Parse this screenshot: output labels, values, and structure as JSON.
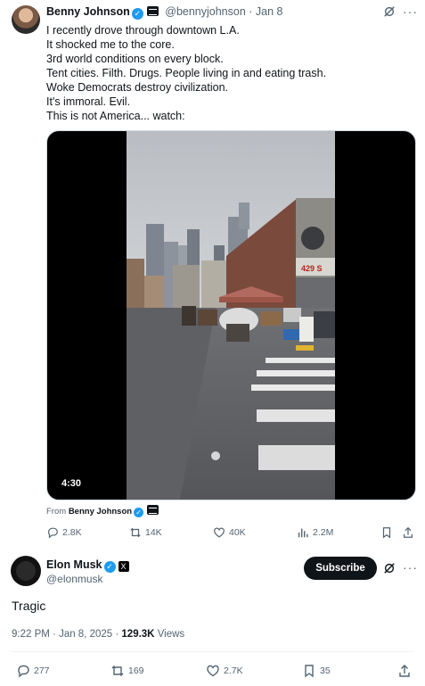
{
  "tweet1": {
    "author_name": "Benny Johnson",
    "handle": "@bennyjohnson",
    "date": "Jan 8",
    "lines": [
      "I recently drove through downtown L.A.",
      "It shocked me to the core.",
      "3rd world conditions on every block.",
      "Tent cities. Filth. Drugs. People living in and eating trash.",
      "Woke Democrats destroy civilization.",
      "It's immoral. Evil.",
      "This is not America... watch:"
    ],
    "video_duration": "4:30",
    "from_label": "From",
    "from_name": "Benny Johnson",
    "replies": "2.8K",
    "reposts": "14K",
    "likes": "40K",
    "views": "2.2M"
  },
  "tweet2": {
    "author_name": "Elon Musk",
    "handle": "@elonmusk",
    "subscribe_label": "Subscribe",
    "text": "Tragic",
    "time": "9:22 PM",
    "date": "Jan 8, 2025",
    "views_count": "129.3K",
    "views_label": "Views",
    "replies": "277",
    "reposts": "169",
    "likes": "2.7K",
    "bookmarks": "35"
  },
  "colors": {
    "accent": "#1d9bf0",
    "text": "#0f1419",
    "muted": "#536471"
  },
  "icons": [
    "grok-icon",
    "more-icon",
    "reply-icon",
    "repost-icon",
    "like-icon",
    "views-icon",
    "bookmark-icon",
    "share-icon",
    "verified-icon",
    "x-logo-icon"
  ]
}
